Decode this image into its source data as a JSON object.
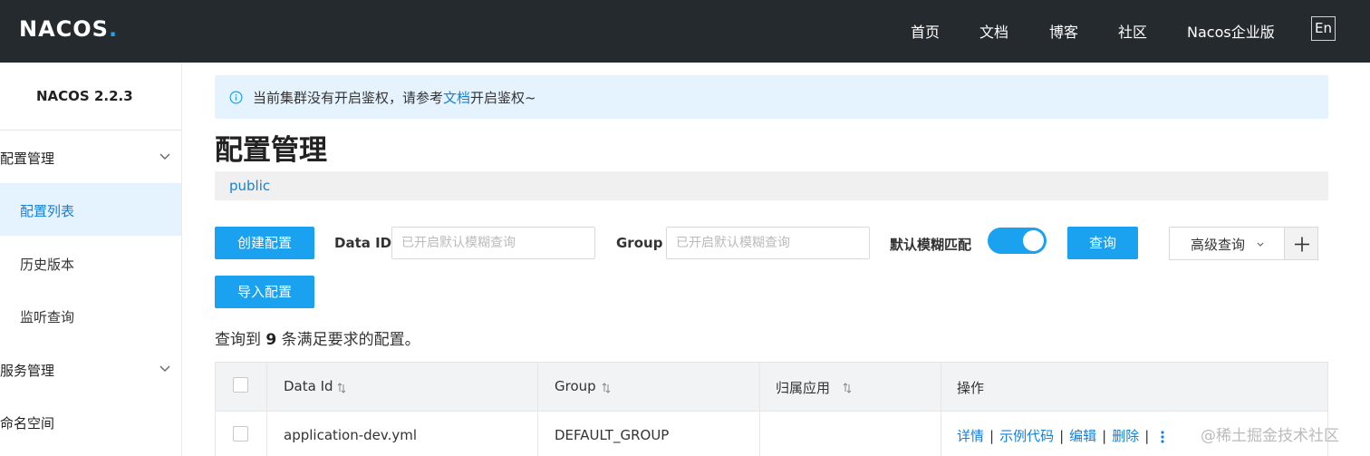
{
  "header": {
    "logo": "NACOS",
    "nav": [
      "首页",
      "文档",
      "博客",
      "社区",
      "Nacos企业版"
    ],
    "lang": "En"
  },
  "sidebar": {
    "version": "NACOS 2.2.3",
    "groups": [
      {
        "label": "配置管理",
        "icon": "chevron-down-icon"
      },
      {
        "label": "服务管理",
        "icon": "chevron-down-icon"
      },
      {
        "label": "命名空间"
      }
    ],
    "items": [
      {
        "label": "配置列表",
        "active": true
      },
      {
        "label": "历史版本"
      },
      {
        "label": "监听查询"
      }
    ]
  },
  "alert": {
    "icon": "info-icon",
    "prefix": "当前集群没有开启鉴权，请参考",
    "link": "文档",
    "suffix": "开启鉴权~"
  },
  "page": {
    "title": "配置管理",
    "namespace": "public"
  },
  "toolbar": {
    "create_label": "创建配置",
    "import_label": "导入配置",
    "data_id_label": "Data ID",
    "data_id_placeholder": "已开启默认模糊查询",
    "group_label": "Group",
    "group_placeholder": "已开启默认模糊查询",
    "fuzzy_label": "默认模糊匹配",
    "fuzzy_on": true,
    "search_label": "查询",
    "advanced_label": "高级查询"
  },
  "result": {
    "prefix": "查询到",
    "count": "9",
    "suffix": "条满足要求的配置。"
  },
  "table": {
    "headers": [
      "Data Id",
      "Group",
      "归属应用",
      "操作"
    ],
    "rows": [
      {
        "data_id": "application-dev.yml",
        "group": "DEFAULT_GROUP",
        "app": "",
        "actions": [
          "详情",
          "示例代码",
          "编辑",
          "删除"
        ]
      }
    ]
  },
  "colors": {
    "header_bg": "#252a2f",
    "primary": "#1aa1f0",
    "link": "#1580d9",
    "active_bg": "#e5f2ff"
  },
  "watermark": "@稀土掘金技术社区"
}
